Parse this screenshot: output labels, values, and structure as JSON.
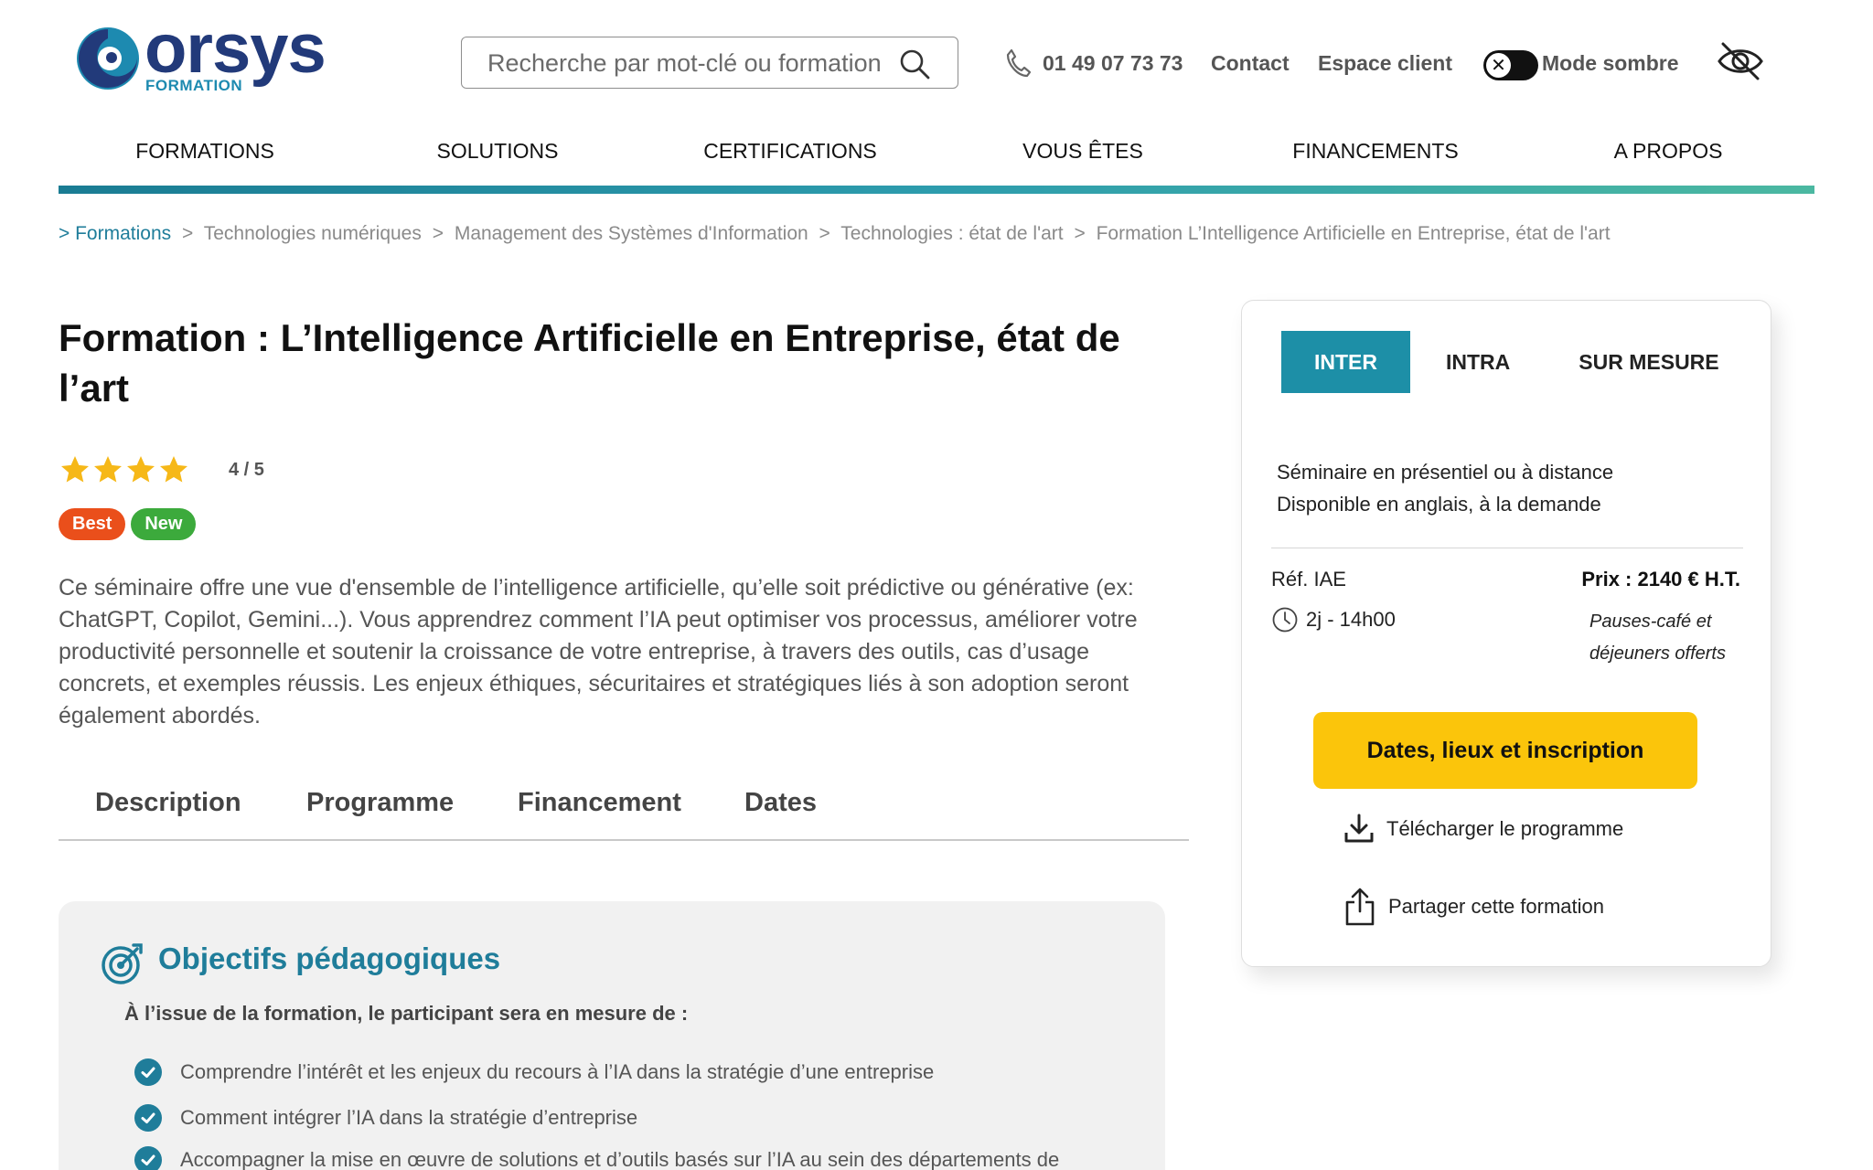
{
  "header": {
    "logo_text": "orsys",
    "logo_sub": "FORMATION",
    "search_placeholder": "Recherche par mot-clé ou formation",
    "phone": "01 49 07 73 73",
    "contact": "Contact",
    "espace_client": "Espace client",
    "dark_mode_label": "Mode sombre",
    "dark_mode_toggle_glyph": "✕"
  },
  "nav": {
    "items": [
      {
        "label": "FORMATIONS"
      },
      {
        "label": "SOLUTIONS"
      },
      {
        "label": "CERTIFICATIONS"
      },
      {
        "label": "VOUS ÊTES"
      },
      {
        "label": "FINANCEMENTS"
      },
      {
        "label": "A PROPOS"
      }
    ]
  },
  "breadcrumb": {
    "items": [
      "> Formations",
      "Technologies numériques",
      "Management des Systèmes d'Information",
      "Technologies : état de l'art",
      "Formation L’Intelligence Artificielle en Entreprise, état de l'art"
    ],
    "separator": ">"
  },
  "course": {
    "title": "Formation : L’Intelligence Artificielle en Entreprise, état de l’art",
    "rating_value": 4,
    "rating_max": 5,
    "rating_text": "4 / 5",
    "badges": {
      "best": "Best",
      "new": "New"
    },
    "intro": "Ce séminaire offre une vue d'ensemble de l’intelligence artificielle, qu’elle soit prédictive ou générative (ex: ChatGPT, Copilot, Gemini...). Vous apprendrez comment l’IA peut optimiser vos processus, améliorer votre productivité personnelle et soutenir la croissance de votre entreprise, à travers des outils, cas d’usage concrets, et exemples réussis. Les enjeux éthiques, sécuritaires et stratégiques liés à son adoption seront également abordés."
  },
  "tabs": {
    "description": "Description",
    "programme": "Programme",
    "financement": "Financement",
    "dates": "Dates"
  },
  "objectives": {
    "title": "Objectifs pédagogiques",
    "lead": "À l’issue de la formation, le participant sera en mesure de :",
    "items": [
      "Comprendre l’intérêt et les enjeux du recours à l’IA dans la stratégie d’une entreprise",
      "Comment intégrer l’IA dans la stratégie d’entreprise",
      "Accompagner la mise en œuvre de solutions et d’outils basés sur l’IA au sein des départements de"
    ]
  },
  "card": {
    "tabs": {
      "inter": "INTER",
      "intra": "INTRA",
      "sur_mesure": "SUR MESURE"
    },
    "info_line1": "Séminaire en présentiel ou à distance",
    "info_line2": "Disponible en anglais, à la demande",
    "ref": "Réf. IAE",
    "duration": "2j - 14h00",
    "price": "Prix : 2140 € H.T.",
    "price_note": "Pauses-café et déjeuners offerts",
    "cta": "Dates, lieux et inscription",
    "download": "Télécharger le programme",
    "share": "Partager cette formation"
  },
  "colors": {
    "brand_blue": "#223a7a",
    "teal": "#1d8fa7",
    "cta_yellow": "#fbc50b",
    "best_orange": "#ea4f1b",
    "new_green": "#3caa3c",
    "star": "#f6b818"
  }
}
